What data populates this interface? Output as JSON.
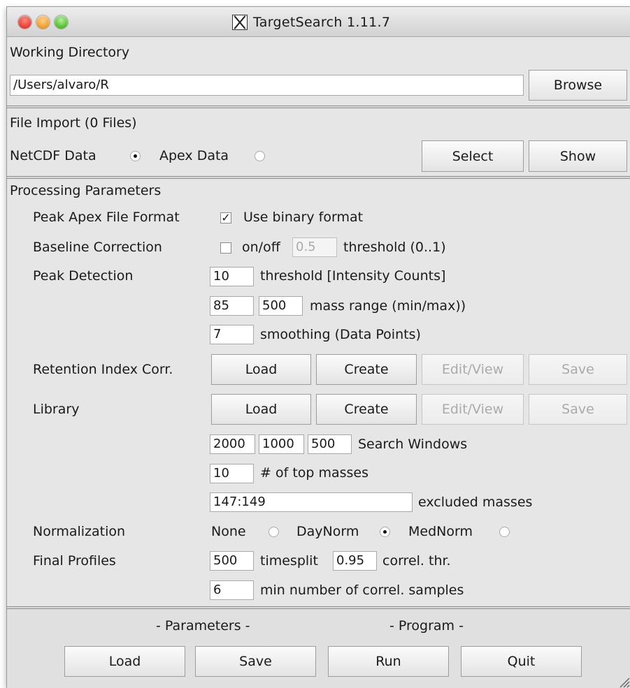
{
  "window": {
    "title": "TargetSearch 1.11.7",
    "traffic_colors": [
      "#e8453c",
      "#f2a33a",
      "#5cc43a"
    ]
  },
  "working_directory": {
    "heading": "Working Directory",
    "path_value": "/Users/alvaro/R",
    "browse_label": "Browse"
  },
  "file_import": {
    "heading": "File Import (0 Files)",
    "netcdf_label": "NetCDF Data",
    "apex_label": "Apex Data",
    "selected_format": "NetCDF Data",
    "select_label": "Select",
    "show_label": "Show"
  },
  "processing": {
    "heading": "Processing Parameters",
    "peak_apex": {
      "label": "Peak Apex File Format",
      "checkbox_label": "Use binary format",
      "checked": true
    },
    "baseline": {
      "label": "Baseline Correction",
      "checkbox_label": "on/off",
      "checked": false,
      "threshold_value": "0.5",
      "threshold_label": "threshold (0..1)"
    },
    "peak_detection": {
      "label": "Peak Detection",
      "threshold_value": "10",
      "threshold_label": "threshold [Intensity Counts]",
      "mass_min": "85",
      "mass_max": "500",
      "mass_label": "mass range (min/max))",
      "smoothing_value": "7",
      "smoothing_label": "smoothing (Data Points)"
    },
    "retention_index": {
      "label": "Retention Index Corr.",
      "load_label": "Load",
      "create_label": "Create",
      "editview_label": "Edit/View",
      "save_label": "Save"
    },
    "library": {
      "label": "Library",
      "load_label": "Load",
      "create_label": "Create",
      "editview_label": "Edit/View",
      "save_label": "Save",
      "window_1": "2000",
      "window_2": "1000",
      "window_3": "500",
      "windows_label": "Search Windows",
      "top_masses_value": "10",
      "top_masses_label": "# of top masses",
      "excluded_value": "147:149",
      "excluded_label": "excluded masses"
    },
    "normalization": {
      "label": "Normalization",
      "none_label": "None",
      "daynorm_label": "DayNorm",
      "mednorm_label": "MedNorm",
      "selected": "DayNorm"
    },
    "final_profiles": {
      "label": "Final Profiles",
      "timesplit_value": "500",
      "timesplit_label": "timesplit",
      "correl_value": "0.95",
      "correl_label": "correl. thr.",
      "min_samples_value": "6",
      "min_samples_label": "min number of correl. samples"
    }
  },
  "bottom": {
    "parameters_heading": "- Parameters -",
    "program_heading": "- Program -",
    "load_label": "Load",
    "save_label": "Save",
    "run_label": "Run",
    "quit_label": "Quit"
  }
}
